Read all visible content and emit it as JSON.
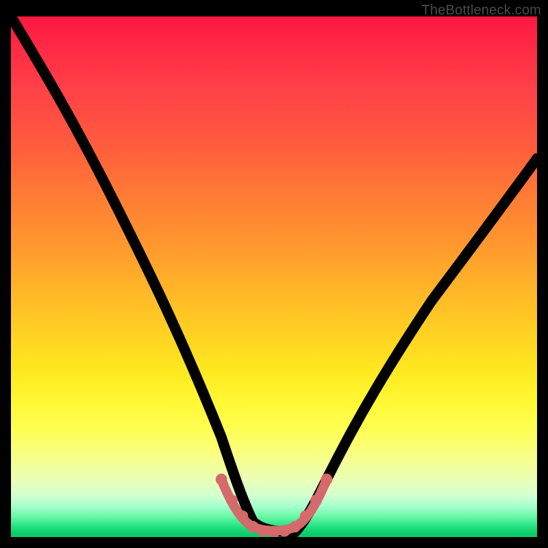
{
  "watermark": "TheBottleneck.com",
  "chart_data": {
    "type": "line",
    "title": "",
    "xlabel": "",
    "ylabel": "",
    "xlim": [
      0,
      100
    ],
    "ylim": [
      0,
      100
    ],
    "grid": false,
    "legend": false,
    "gradient_stops": [
      {
        "pos": 0,
        "color": "#ff173f"
      },
      {
        "pos": 24,
        "color": "#ff5a3e"
      },
      {
        "pos": 52,
        "color": "#ffb428"
      },
      {
        "pos": 74,
        "color": "#fff833"
      },
      {
        "pos": 92,
        "color": "#d4ffcf"
      },
      {
        "pos": 100,
        "color": "#08c968"
      }
    ],
    "series": [
      {
        "name": "bottleneck-curve",
        "x": [
          0,
          5,
          10,
          15,
          20,
          25,
          30,
          35,
          40,
          43,
          46,
          50,
          54,
          57,
          60,
          65,
          70,
          75,
          80,
          85,
          90,
          95,
          100
        ],
        "values": [
          100,
          92,
          83,
          74,
          64,
          54,
          44,
          33,
          20,
          10,
          4,
          2,
          2,
          4,
          10,
          20,
          30,
          38,
          46,
          53,
          60,
          67,
          73
        ]
      }
    ],
    "highlight_segment": {
      "name": "near-zero-band",
      "color": "#d46a6a",
      "x": [
        40,
        43,
        46,
        50,
        54,
        57,
        60
      ],
      "values": [
        12,
        6,
        3,
        2,
        3,
        6,
        12
      ]
    },
    "annotations": []
  }
}
